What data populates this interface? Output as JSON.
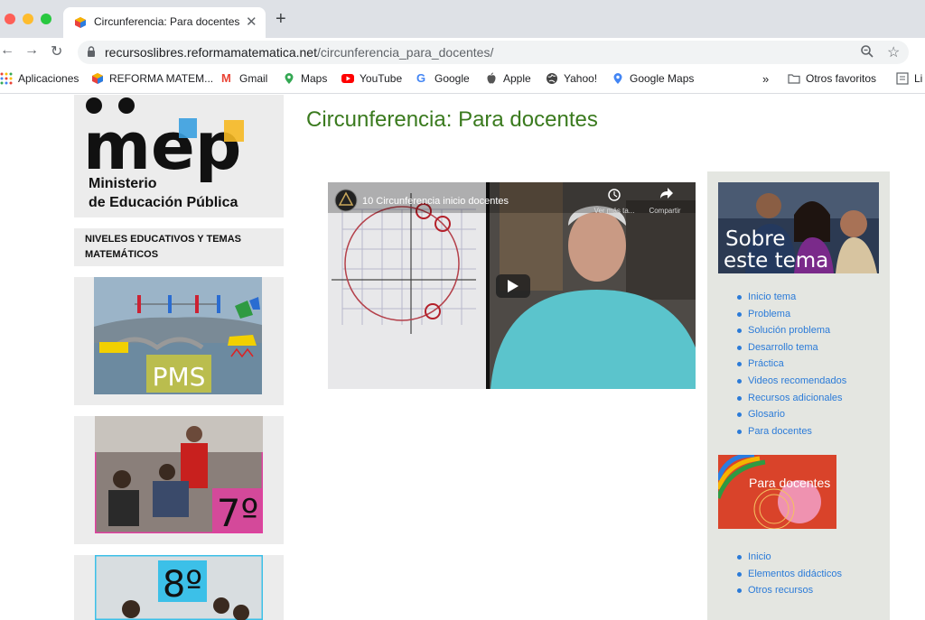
{
  "browser": {
    "tab_title": "Circunferencia: Para docentes",
    "tab_close": "✕",
    "new_tab": "+",
    "url_domain": "recursoslibres.reformamatematica.net",
    "url_path": "/circunferencia_para_docentes/",
    "bookmarks": [
      "Aplicaciones",
      "REFORMA MATEM...",
      "Gmail",
      "Maps",
      "YouTube",
      "Google",
      "Apple",
      "Yahoo!",
      "Google Maps"
    ],
    "more": "»",
    "other_favorites": "Otros favoritos",
    "reading_list": "Li"
  },
  "sidebar_left": {
    "logo_text": "mep",
    "logo_line1": "Ministerio",
    "logo_line2": "de Educación Pública",
    "niveles": "NIVELES EDUCATIVOS Y TEMAS MATEMÁTICOS",
    "card1_label": "PMS",
    "card2_label": "7º",
    "card3_label": "8º"
  },
  "main": {
    "title": "Circunferencia: Para docentes",
    "video": {
      "title": "10 Circunferencia inicio docentes",
      "watch_later": "Ver más ta...",
      "share": "Compartir"
    }
  },
  "sidebar_right": {
    "banner_line1": "Sobre",
    "banner_line2": "este tema",
    "menu": [
      "Inicio tema",
      "Problema",
      "Solución problema",
      "Desarrollo tema",
      "Práctica",
      "Videos recomendados",
      "Recursos adicionales",
      "Glosario",
      "Para docentes"
    ],
    "docentes_label": "Para docentes",
    "menu2": [
      "Inicio",
      "Elementos didácticos",
      "Otros recursos"
    ]
  },
  "colors": {
    "title_green": "#3a7a1e",
    "link_blue": "#2b7bd8",
    "sidebar_bg": "#e4e6e1"
  }
}
